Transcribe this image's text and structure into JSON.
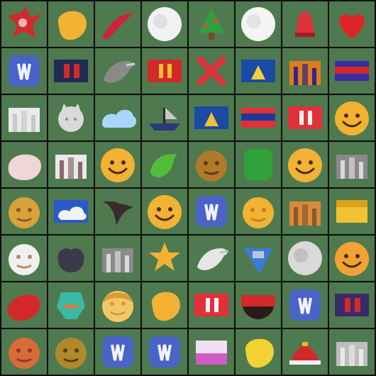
{
  "grid": {
    "rows": 8,
    "cols": 8,
    "background": "#4f7a4f",
    "cells": [
      {
        "kind": "red-splash",
        "colors": [
          "#d22a2a",
          "#8a1a1a"
        ]
      },
      {
        "kind": "yellow-blob",
        "colors": [
          "#f2b233",
          "#d98a20"
        ]
      },
      {
        "kind": "red-swoosh",
        "colors": [
          "#d0223a",
          "#7a1a2a"
        ]
      },
      {
        "kind": "white-round",
        "colors": [
          "#f2f2f2",
          "#c9c9c9"
        ]
      },
      {
        "kind": "tree",
        "colors": [
          "#2f9f3f",
          "#d44a3a"
        ]
      },
      {
        "kind": "white-round",
        "colors": [
          "#f4f4f4",
          "#cfcfcf"
        ]
      },
      {
        "kind": "red-bell",
        "colors": [
          "#e0303a",
          "#a21f2a"
        ]
      },
      {
        "kind": "heart",
        "colors": [
          "#e0252a",
          "#b21a1f"
        ]
      },
      {
        "kind": "blue-app",
        "colors": [
          "#4a63c7",
          "#f2f2ff"
        ]
      },
      {
        "kind": "dark-flag",
        "colors": [
          "#1f2a55",
          "#d22a2a"
        ]
      },
      {
        "kind": "grey-bird",
        "colors": [
          "#8a8a8a",
          "#cfcfcf"
        ]
      },
      {
        "kind": "red-flag",
        "colors": [
          "#d22a2a",
          "#f2c233"
        ]
      },
      {
        "kind": "red-cross",
        "colors": [
          "#e0303a",
          "#b21a1f"
        ]
      },
      {
        "kind": "blue-flag",
        "colors": [
          "#1a4aa3",
          "#f2d233"
        ]
      },
      {
        "kind": "orange-scene",
        "colors": [
          "#e07a1a",
          "#2a2a8a"
        ]
      },
      {
        "kind": "stripe-flag",
        "colors": [
          "#d22a2a",
          "#3a2aa3"
        ]
      },
      {
        "kind": "white-figure",
        "colors": [
          "#eaeaea",
          "#c9c9c9"
        ]
      },
      {
        "kind": "grey-cat",
        "colors": [
          "#d9d9d9",
          "#8a8a8a"
        ]
      },
      {
        "kind": "blue-cloud",
        "colors": [
          "#a8d6ff",
          "#6aa6ff"
        ]
      },
      {
        "kind": "boat",
        "colors": [
          "#2a3a7a",
          "#c9c9c9"
        ]
      },
      {
        "kind": "blue-flag",
        "colors": [
          "#1a4aa3",
          "#f2c233"
        ]
      },
      {
        "kind": "stripe-flag",
        "colors": [
          "#1a3a9a",
          "#e0303a"
        ]
      },
      {
        "kind": "red-flag",
        "colors": [
          "#e0303a",
          "#f2f2f2"
        ]
      },
      {
        "kind": "smiley",
        "colors": [
          "#f2b233",
          "#d98a20"
        ]
      },
      {
        "kind": "pink-blob",
        "colors": [
          "#f0d6d6",
          "#c9a3a3"
        ]
      },
      {
        "kind": "white-ruins",
        "colors": [
          "#e9e9e9",
          "#8a6a6a"
        ]
      },
      {
        "kind": "smiley",
        "colors": [
          "#f2b233",
          "#d98a20"
        ]
      },
      {
        "kind": "green-bird",
        "colors": [
          "#4fbf3a",
          "#2a8a2a"
        ]
      },
      {
        "kind": "brown-face",
        "colors": [
          "#b07a2a",
          "#5a3a1a"
        ]
      },
      {
        "kind": "green-block",
        "colors": [
          "#2fa33a",
          "#1f7a2a"
        ]
      },
      {
        "kind": "smiley",
        "colors": [
          "#f2b233",
          "#d98a20"
        ]
      },
      {
        "kind": "building",
        "colors": [
          "#8a8a8a",
          "#d9d9d9"
        ]
      },
      {
        "kind": "golden-face",
        "colors": [
          "#d9a23a",
          "#8a5a2a"
        ]
      },
      {
        "kind": "blue-cloud-flag",
        "colors": [
          "#2a5ac9",
          "#f2f2f2"
        ]
      },
      {
        "kind": "dark-bird",
        "colors": [
          "#3a2a2a",
          "#8a8a8a"
        ]
      },
      {
        "kind": "smiley",
        "colors": [
          "#f2b233",
          "#d98a20"
        ]
      },
      {
        "kind": "blue-app",
        "colors": [
          "#4a63c7",
          "#f2f2ff"
        ]
      },
      {
        "kind": "yellow-face",
        "colors": [
          "#f2b233",
          "#c9801a"
        ]
      },
      {
        "kind": "orange-ruins",
        "colors": [
          "#d98a3a",
          "#8a5a2a"
        ]
      },
      {
        "kind": "yellow-flag",
        "colors": [
          "#f2c233",
          "#d9a21a"
        ]
      },
      {
        "kind": "white-face",
        "colors": [
          "#f0f0f0",
          "#b98a6a"
        ]
      },
      {
        "kind": "dark-apple",
        "colors": [
          "#3a3a4a",
          "#7a7a8a"
        ]
      },
      {
        "kind": "grey-scene",
        "colors": [
          "#8a8a8a",
          "#d9d9d9"
        ]
      },
      {
        "kind": "yellow-star",
        "colors": [
          "#f2b233",
          "#d98a20"
        ]
      },
      {
        "kind": "white-bird",
        "colors": [
          "#e6e6e6",
          "#bfbfbf"
        ]
      },
      {
        "kind": "blue-shape",
        "colors": [
          "#3a7ad9",
          "#d9d9d9"
        ]
      },
      {
        "kind": "white-round",
        "colors": [
          "#d9d9d9",
          "#a3a3a3"
        ]
      },
      {
        "kind": "smiley",
        "colors": [
          "#f2a233",
          "#d98a20"
        ]
      },
      {
        "kind": "red-blob",
        "colors": [
          "#d22a2a",
          "#a21a1a"
        ]
      },
      {
        "kind": "rainbow-figure",
        "colors": [
          "#3ab9a3",
          "#e07a3a"
        ]
      },
      {
        "kind": "blond-face",
        "colors": [
          "#f2c866",
          "#d99a3a"
        ]
      },
      {
        "kind": "yellow-blob",
        "colors": [
          "#f2b233",
          "#d98a20"
        ]
      },
      {
        "kind": "red-flag",
        "colors": [
          "#e0303a",
          "#f2f2f2"
        ]
      },
      {
        "kind": "dark-bowl",
        "colors": [
          "#2a1a1a",
          "#d22a2a"
        ]
      },
      {
        "kind": "blue-app",
        "colors": [
          "#4a63c7",
          "#f2f2ff"
        ]
      },
      {
        "kind": "dark-flag",
        "colors": [
          "#3a2a6a",
          "#d22a2a"
        ]
      },
      {
        "kind": "orange-face",
        "colors": [
          "#d96a3a",
          "#8a3a2a"
        ]
      },
      {
        "kind": "brown-face",
        "colors": [
          "#b08a2a",
          "#5a3a1a"
        ]
      },
      {
        "kind": "blue-app",
        "colors": [
          "#4a63c7",
          "#f2f2ff"
        ]
      },
      {
        "kind": "blue-app",
        "colors": [
          "#4a63c7",
          "#f2f2ff"
        ]
      },
      {
        "kind": "pink-card",
        "colors": [
          "#f0e0f0",
          "#c93ab9"
        ]
      },
      {
        "kind": "yellow-blob",
        "colors": [
          "#f2d233",
          "#d9b21a"
        ]
      },
      {
        "kind": "red-hat",
        "colors": [
          "#d22a2a",
          "#f2f2f2"
        ]
      },
      {
        "kind": "grey-scene",
        "colors": [
          "#bdbdbd",
          "#e9e9e9"
        ]
      }
    ]
  }
}
